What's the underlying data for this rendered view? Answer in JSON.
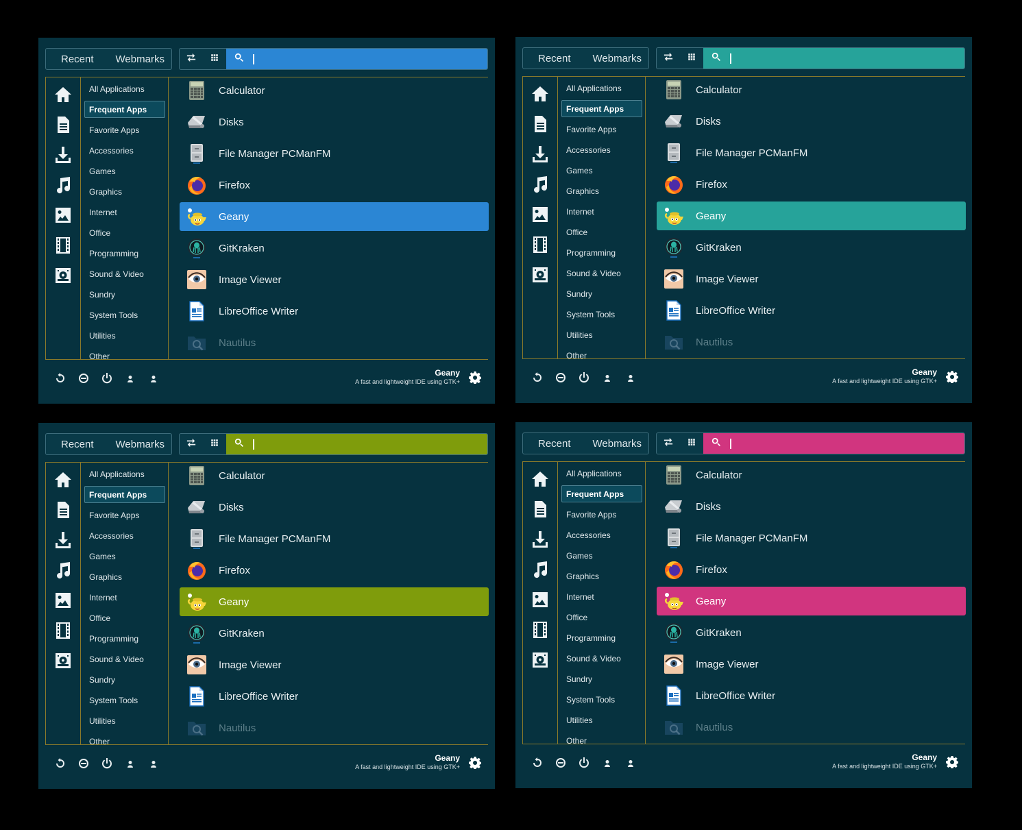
{
  "tabs": {
    "recent": "Recent",
    "webmarks": "Webmarks"
  },
  "categories": [
    "All Applications",
    "Frequent Apps",
    "Favorite Apps",
    "Accessories",
    "Games",
    "Graphics",
    "Internet",
    "Office",
    "Programming",
    "Sound & Video",
    "Sundry",
    "System Tools",
    "Utilities",
    "Other"
  ],
  "active_category": "Frequent Apps",
  "apps": [
    {
      "label": "Calculator",
      "icon": "calculator-icon"
    },
    {
      "label": "Disks",
      "icon": "disks-icon"
    },
    {
      "label": "File Manager PCManFM",
      "icon": "file-cabinet-icon"
    },
    {
      "label": "Firefox",
      "icon": "firefox-icon"
    },
    {
      "label": "Geany",
      "icon": "geany-teapot-icon"
    },
    {
      "label": "GitKraken",
      "icon": "gitkraken-icon"
    },
    {
      "label": "Image Viewer",
      "icon": "eye-icon"
    },
    {
      "label": "LibreOffice Writer",
      "icon": "writer-document-icon"
    },
    {
      "label": "Nautilus",
      "icon": "nautilus-folder-icon"
    }
  ],
  "selected_app": "Geany",
  "info": {
    "name": "Geany",
    "description": "A fast and lightweight IDE using GTK+"
  },
  "places": [
    "home-icon",
    "document-icon",
    "download-icon",
    "music-icon",
    "picture-icon",
    "video-icon",
    "drive-icon"
  ],
  "power_buttons": [
    "restart-icon",
    "logout-icon",
    "power-icon",
    "user-icon",
    "user-switch-icon"
  ],
  "search_placeholder": "",
  "menus": [
    {
      "variant": "blue",
      "accent": "#2b86d4"
    },
    {
      "variant": "teal",
      "accent": "#26a39a"
    },
    {
      "variant": "olive",
      "accent": "#7f9c0c"
    },
    {
      "variant": "pink",
      "accent": "#d1357f"
    }
  ],
  "colors": {
    "background": "#06323f",
    "border": "#8a7a2a",
    "page": "#000000"
  }
}
